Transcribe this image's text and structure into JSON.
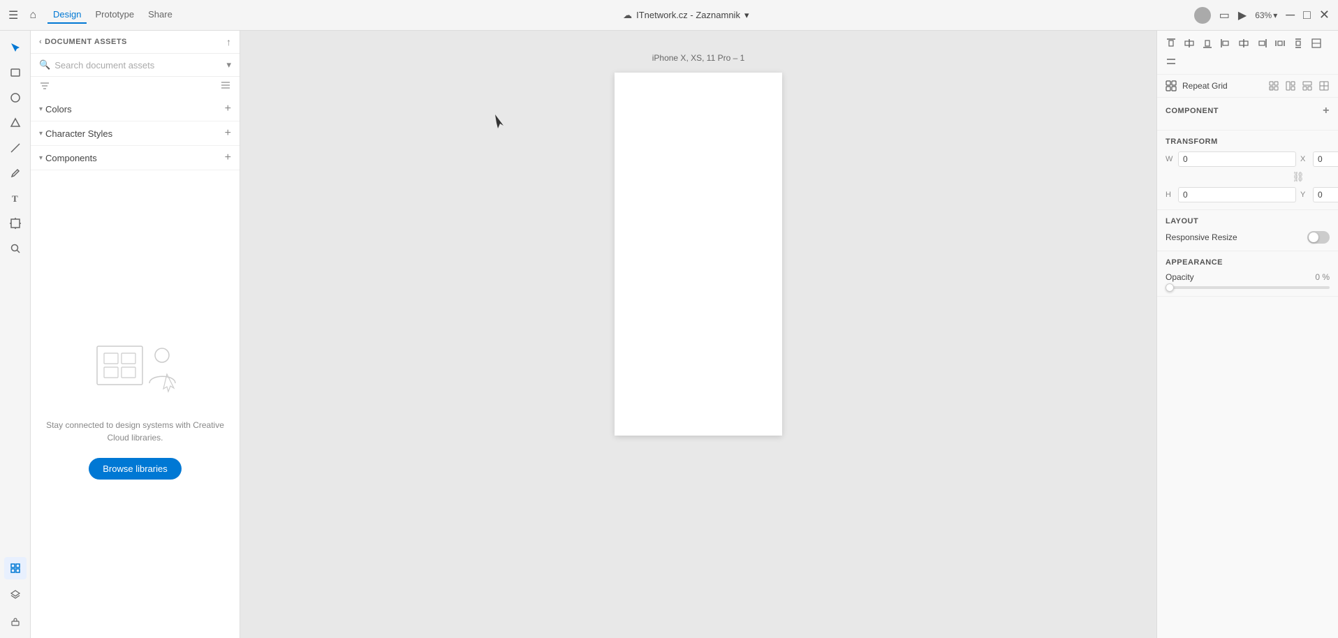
{
  "topbar": {
    "tabs": [
      {
        "id": "design",
        "label": "Design",
        "active": true
      },
      {
        "id": "prototype",
        "label": "Prototype",
        "active": false
      },
      {
        "id": "share",
        "label": "Share",
        "active": false
      }
    ],
    "title": "ITnetwork.cz - Zaznamnik",
    "zoom": "63%",
    "hamburger_label": "☰",
    "home_label": "🏠",
    "cloud_label": "☁",
    "chevron_label": "▾",
    "avatar_label": "",
    "device_label": "📱",
    "play_label": "▶"
  },
  "left_panel": {
    "header_title": "DOCUMENT ASSETS",
    "upload_icon": "↑",
    "back_icon": "‹",
    "search_placeholder": "Search document assets",
    "filter_icon": "▾",
    "sections": [
      {
        "id": "colors",
        "label": "Colors",
        "expanded": true
      },
      {
        "id": "character-styles",
        "label": "Character Styles",
        "expanded": true
      },
      {
        "id": "components",
        "label": "Components",
        "expanded": true
      }
    ],
    "empty_text": "Stay connected to design systems with Creative Cloud libraries.",
    "browse_label": "Browse libraries"
  },
  "canvas": {
    "artboard_label": "iPhone X, XS, 11 Pro – 1"
  },
  "right_panel": {
    "align_buttons": [
      "⬛",
      "▐",
      "▌",
      "—",
      "≡",
      "↕",
      "↔",
      "⬛",
      "⬛",
      "⬛"
    ],
    "repeat_grid_label": "Repeat Grid",
    "component_title": "COMPONENT",
    "transform_title": "TRANSFORM",
    "transform_fields": [
      {
        "label": "W",
        "value": "0"
      },
      {
        "label": "X",
        "value": "0"
      },
      {
        "label": "H",
        "value": "0"
      },
      {
        "label": "Y",
        "value": "0"
      }
    ],
    "layout_title": "LAYOUT",
    "responsive_resize_label": "Responsive Resize",
    "appearance_title": "APPEARANCE",
    "opacity_label": "Opacity",
    "opacity_value": "0 %",
    "add_icon": "+",
    "link_icon": "⛓"
  }
}
